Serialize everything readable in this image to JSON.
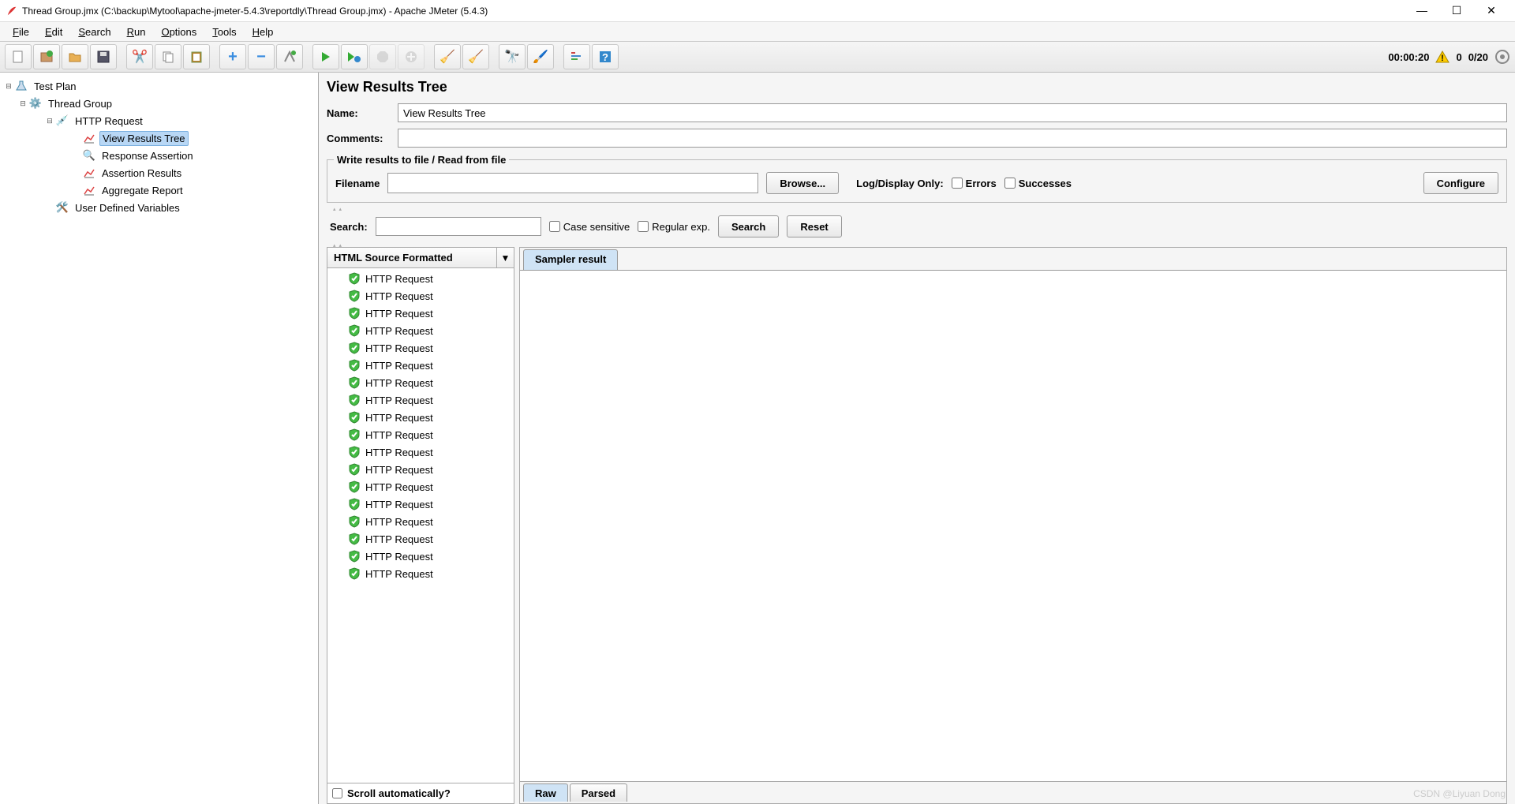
{
  "window": {
    "title": "Thread Group.jmx (C:\\backup\\Mytool\\apache-jmeter-5.4.3\\reportdly\\Thread Group.jmx) - Apache JMeter (5.4.3)"
  },
  "menu": {
    "file": "File",
    "edit": "Edit",
    "search": "Search",
    "run": "Run",
    "options": "Options",
    "tools": "Tools",
    "help": "Help"
  },
  "toolbar_status": {
    "time": "00:00:20",
    "errors": "0",
    "threads": "0/20"
  },
  "tree": {
    "test_plan": "Test Plan",
    "thread_group": "Thread Group",
    "http_request": "HTTP Request",
    "view_results_tree": "View Results Tree",
    "response_assertion": "Response Assertion",
    "assertion_results": "Assertion Results",
    "aggregate_report": "Aggregate Report",
    "user_defined_variables": "User Defined Variables"
  },
  "panel": {
    "title": "View Results Tree",
    "name_label": "Name:",
    "name_value": "View Results Tree",
    "comments_label": "Comments:",
    "file_legend": "Write results to file / Read from file",
    "filename_label": "Filename",
    "browse": "Browse...",
    "log_display_only": "Log/Display Only:",
    "errors": "Errors",
    "successes": "Successes",
    "configure": "Configure",
    "search_label": "Search:",
    "case_sensitive": "Case sensitive",
    "regular_exp": "Regular exp.",
    "search_btn": "Search",
    "reset_btn": "Reset",
    "renderer": "HTML Source Formatted",
    "sampler_result_tab": "Sampler result",
    "raw_tab": "Raw",
    "parsed_tab": "Parsed",
    "scroll_auto": "Scroll automatically?"
  },
  "results": [
    "HTTP Request",
    "HTTP Request",
    "HTTP Request",
    "HTTP Request",
    "HTTP Request",
    "HTTP Request",
    "HTTP Request",
    "HTTP Request",
    "HTTP Request",
    "HTTP Request",
    "HTTP Request",
    "HTTP Request",
    "HTTP Request",
    "HTTP Request",
    "HTTP Request",
    "HTTP Request",
    "HTTP Request",
    "HTTP Request"
  ],
  "watermark": "CSDN @Liyuan Dong"
}
